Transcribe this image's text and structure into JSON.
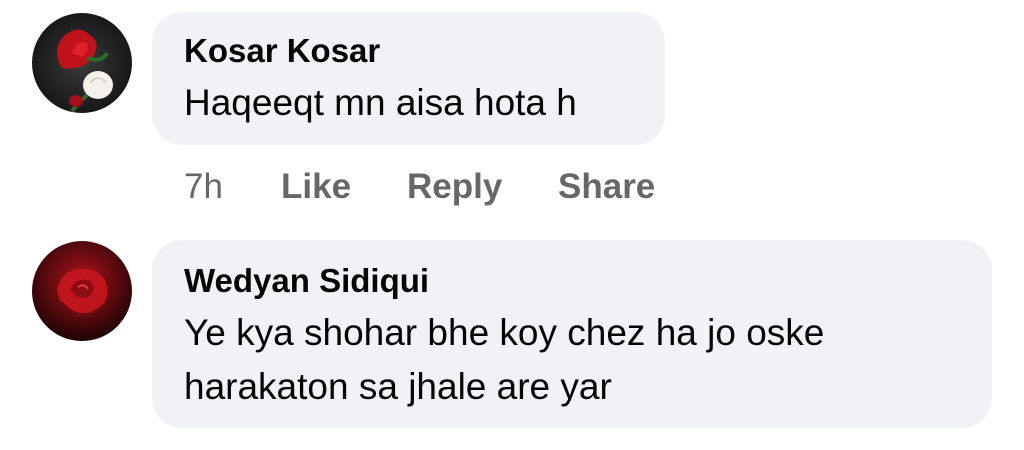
{
  "comments": [
    {
      "author": "Kosar Kosar",
      "text_lines": [
        "Haqeeqt mn aisa hota h"
      ],
      "time": "7h",
      "like_label": "Like",
      "reply_label": "Reply",
      "share_label": "Share",
      "avatar_icon": "rose-icon"
    },
    {
      "author": "Wedyan Sidiqui",
      "text_lines": [
        "Ye kya shohar bhe koy chez ha jo oske",
        "harakaton sa jhale are yar"
      ],
      "avatar_icon": "red-rose-icon"
    }
  ],
  "colors": {
    "bubble": "#f0f2f5",
    "text": "#050505",
    "meta": "#65676b"
  }
}
